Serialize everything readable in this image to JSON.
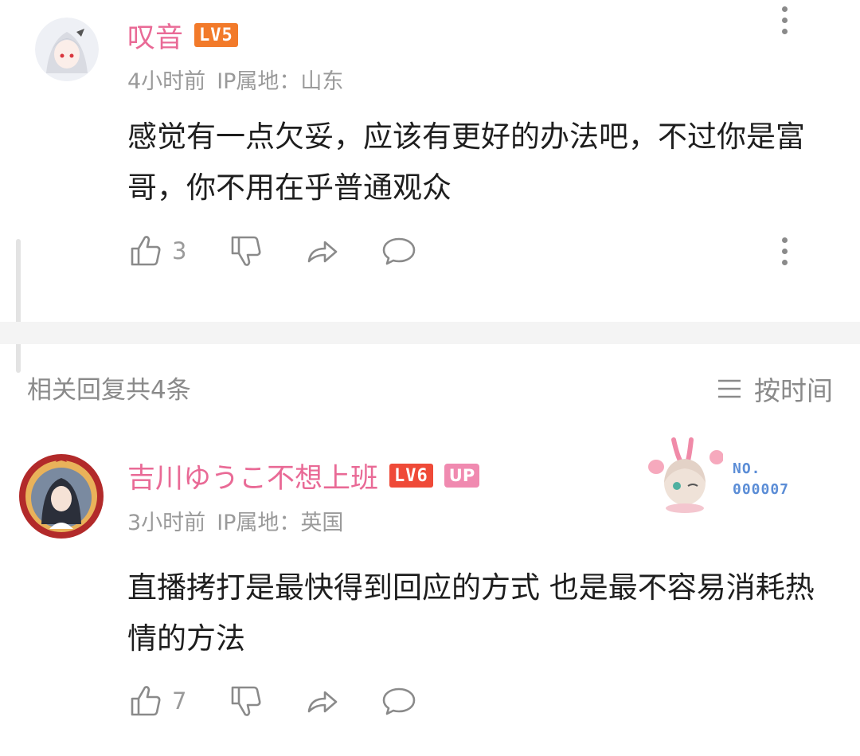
{
  "comments": [
    {
      "username": "叹音",
      "level": "LV5",
      "time": "4小时前",
      "ip": "IP属地：山东",
      "content": "感觉有一点欠妥，应该有更好的办法吧，不过你是富哥，你不用在乎普通观众",
      "likes": "3"
    },
    {
      "username": "吉川ゆうこ不想上班",
      "level": "LV6",
      "up_badge": "UP",
      "time": "3小时前",
      "ip": "IP属地：英国",
      "content": "直播拷打是最快得到回应的方式 也是最不容易消耗热情的方法",
      "likes": "7",
      "badge_card": {
        "line1": "NO.",
        "line2": "000007"
      }
    }
  ],
  "replies_header": {
    "count_label": "相关回复共4条",
    "sort_label": "按时间"
  },
  "colors": {
    "username": "#e96a96",
    "lv5": "#f27a2a",
    "lv6": "#ef4a38",
    "up": "#f08ab0",
    "meta": "#9a9a9a"
  }
}
